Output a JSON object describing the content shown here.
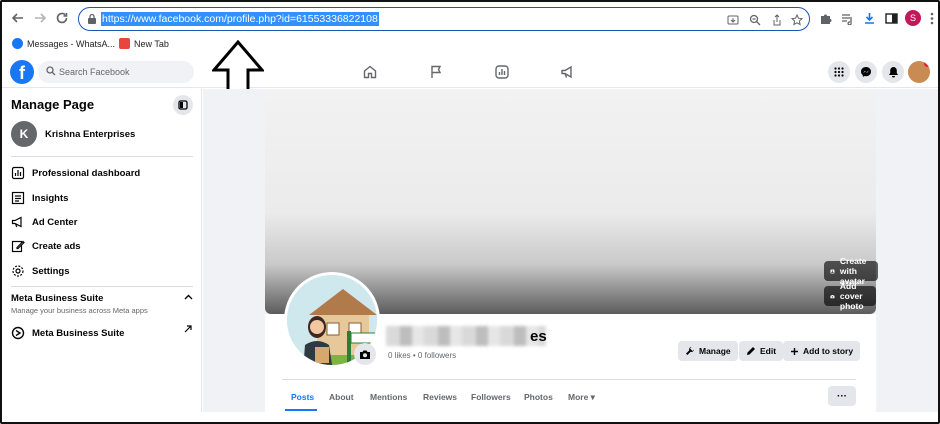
{
  "browser": {
    "url": "https://www.facebook.com/profile.php?id=61553336822108",
    "profile_initial": "S",
    "bookmarks": [
      {
        "label": "Messages - WhatsA..."
      },
      {
        "label": "New Tab"
      }
    ]
  },
  "facebook": {
    "search_placeholder": "Search Facebook"
  },
  "sidebar": {
    "title": "Manage Page",
    "page_initial": "K",
    "page_name": "Krishna Enterprises",
    "items": [
      {
        "label": "Professional dashboard",
        "icon": "dashboard-icon"
      },
      {
        "label": "Insights",
        "icon": "insights-icon"
      },
      {
        "label": "Ad Center",
        "icon": "megaphone-icon"
      },
      {
        "label": "Create ads",
        "icon": "pencil-icon"
      },
      {
        "label": "Settings",
        "icon": "gear-icon"
      }
    ],
    "meta_section_title": "Meta Business Suite",
    "meta_section_subtitle": "Manage your business across Meta apps",
    "meta_link": "Meta Business Suite"
  },
  "cover": {
    "create_avatar": "Create with avatar",
    "add_cover": "Add cover photo"
  },
  "profile": {
    "name_suffix": "es",
    "stats": "0 likes • 0 followers",
    "actions": {
      "manage": "Manage",
      "edit": "Edit",
      "add_story": "Add to story"
    },
    "tabs": [
      "Posts",
      "About",
      "Mentions",
      "Reviews",
      "Followers",
      "Photos",
      "More ▾"
    ],
    "more_label": "···"
  },
  "colors": {
    "brand": "#1877f2",
    "url_selection": "#3390ff",
    "omnibox_border": "#1a56b8"
  }
}
